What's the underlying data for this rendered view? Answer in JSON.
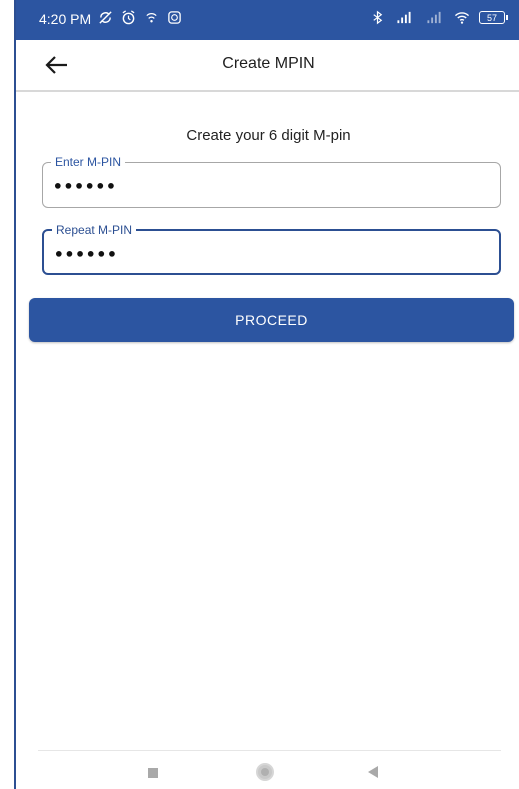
{
  "status_bar": {
    "time": "4:20 PM",
    "battery": "57",
    "icons_left": [
      "no-sync-icon",
      "alarm-icon",
      "wifi-call-icon",
      "whatsapp-icon"
    ],
    "icons_right": [
      "bluetooth-icon",
      "signal-icon",
      "signal-icon-2",
      "wifi-icon",
      "battery-icon"
    ]
  },
  "app_bar": {
    "title": "Create MPIN",
    "back_icon": "arrow-left-icon"
  },
  "form": {
    "subtitle": "Create your 6 digit M-pin",
    "enter_pin": {
      "label": "Enter M-PIN",
      "value": "••••••"
    },
    "repeat_pin": {
      "label": "Repeat M-PIN",
      "value": "••••••"
    },
    "proceed_label": "PROCEED"
  },
  "colors": {
    "primary": "#2c55a1",
    "focused_border": "#2c4f92",
    "idle_border": "#a7a7a7"
  }
}
